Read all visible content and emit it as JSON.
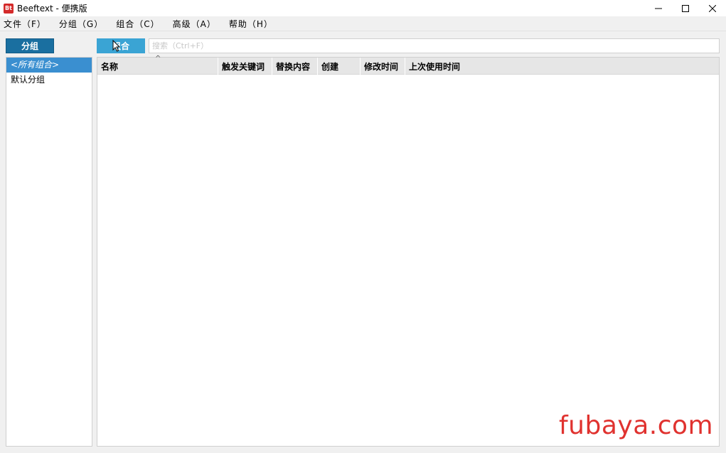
{
  "window": {
    "title": "Beeftext - 便携版",
    "icon_label": "Bt",
    "controls": [
      "minimize-icon",
      "maximize-icon",
      "close-icon"
    ]
  },
  "menubar": {
    "items": [
      "文件（F）",
      "分组（G）",
      "组合（C）",
      "高级（A）",
      "帮助（H）"
    ]
  },
  "sidebar": {
    "button_label": "分组",
    "groups": [
      {
        "label": "<所有组合>",
        "selected": true
      },
      {
        "label": "默认分组",
        "selected": false
      }
    ]
  },
  "main": {
    "button_label": "组合",
    "search": {
      "placeholder": "搜索（Ctrl+F）",
      "value": ""
    },
    "columns": [
      "名称",
      "触发关键词",
      "替换内容",
      "创建",
      "修改时间",
      "上次使用时间"
    ],
    "sort_indicator": "^",
    "rows": []
  },
  "watermark": "fubaya.com",
  "colors": {
    "group_button": "#1a6fa0",
    "combo_button": "#3aa4d4",
    "selected_group": "#3a8fd0",
    "watermark": "#e0322f",
    "app_icon": "#d42a2a"
  }
}
